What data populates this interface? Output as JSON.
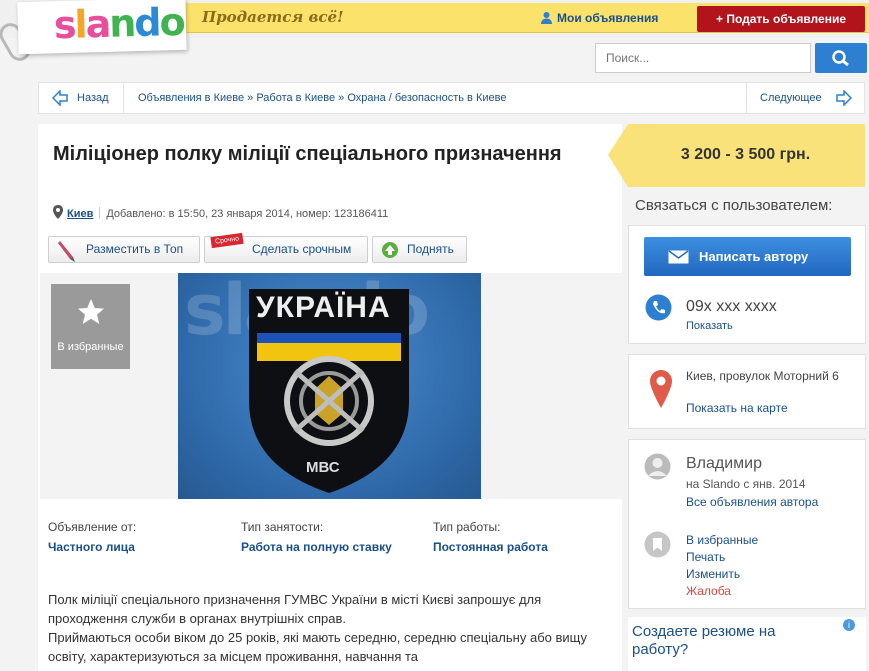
{
  "header": {
    "logo": "slando",
    "slogan": "Продается всё!",
    "my_ads": "Мои объявления",
    "post_ad": "+ Подать объявление",
    "search_placeholder": "Поиск..."
  },
  "breadcrumbs": {
    "back": "Назад",
    "items": [
      "Объявления в Киеве",
      "Работа в Киеве",
      "Охрана / безопасность в Киеве"
    ],
    "next": "Следующее"
  },
  "listing": {
    "title": "Міліціонер полку міліції спеціального призначення",
    "city": "Киев",
    "meta": "Добавлено: в 15:50, 23 января 2014, номер: 123186411",
    "actions": {
      "top": "Разместить в Топ",
      "urgent_badge": "Срочно",
      "urgent": "Сделать срочным",
      "up": "Поднять"
    },
    "favorite": "В избранные",
    "image": {
      "top_text": "УКРАЇНА",
      "bottom_text": "МВС",
      "watermark": "slando"
    },
    "attributes": [
      {
        "label": "Объявление от:",
        "value": "Частного лица"
      },
      {
        "label": "Тип занятости:",
        "value": "Работа на полную ставку"
      },
      {
        "label": "Тип работы:",
        "value": "Постоянная работа"
      }
    ],
    "description": [
      "Полк міліції спеціального призначення ГУМВС України в місті Києві запрошує для проходження служби в органах внутрішніх справ.",
      "Приймаються особи віком до 25 років, які мають середню, середню спеціальну або вищу освіту, характеризуються за місцем проживання, навчання та"
    ]
  },
  "sidebar": {
    "price": "3 200 - 3 500 грн.",
    "contact_heading": "Связаться с пользователем:",
    "write_author": "Написать автору",
    "phone": "09x xxx xxxx",
    "show_phone": "Показать",
    "address": "Киев, провулок Моторний 6",
    "show_map": "Показать на карте",
    "user_name": "Владимир",
    "user_since": "на Slando с янв. 2014",
    "all_ads": "Все объявления автора",
    "links": {
      "favorites": "В избранные",
      "print": "Печать",
      "edit": "Изменить",
      "complain": "Жалоба"
    },
    "ad_text": "Создаете резюме на работу?"
  },
  "colors": {
    "accent_blue": "#1a4f8a",
    "button_blue": "#2d7fd1",
    "post_red": "#b3141b",
    "price_yellow": "#f9e27a"
  }
}
